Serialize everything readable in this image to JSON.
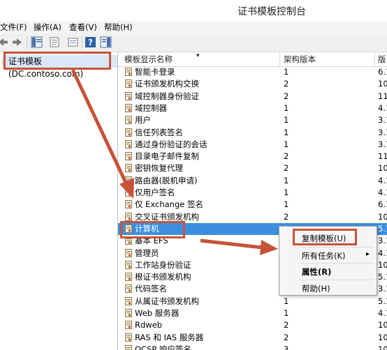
{
  "window": {
    "title": "证书模板控制台"
  },
  "menubar": [
    "文件(F)",
    "操作(A)",
    "查看(V)",
    "帮助(H)"
  ],
  "tree": {
    "root_label": "证书模板(DC.contoso.com)"
  },
  "list": {
    "columns": [
      "模板显示名称",
      "架构版本",
      "版"
    ],
    "rows": [
      {
        "name": "智能卡登录",
        "schema": "1",
        "ver": "6.1"
      },
      {
        "name": "证书颁发机构交换",
        "schema": "2",
        "ver": "10"
      },
      {
        "name": "域控制器身份验证",
        "schema": "2",
        "ver": "11"
      },
      {
        "name": "域控制器",
        "schema": "1",
        "ver": "4.1"
      },
      {
        "name": "用户",
        "schema": "1",
        "ver": "3.1"
      },
      {
        "name": "信任列表签名",
        "schema": "1",
        "ver": "3.1"
      },
      {
        "name": "通过身份验证的会话",
        "schema": "1",
        "ver": "3.1"
      },
      {
        "name": "目录电子邮件复制",
        "schema": "2",
        "ver": "11"
      },
      {
        "name": "密钥恢复代理",
        "schema": "2",
        "ver": "10"
      },
      {
        "name": "路由器(脱机申请)",
        "schema": "1",
        "ver": "4.1"
      },
      {
        "name": "仅用户签名",
        "schema": "1",
        "ver": "4.1"
      },
      {
        "name": "仅 Exchange 签名",
        "schema": "1",
        "ver": "6.1"
      },
      {
        "name": "交叉证书颁发机构",
        "schema": "2",
        "ver": "10"
      },
      {
        "name": "计算机",
        "schema": "1",
        "ver": "5.1"
      },
      {
        "name": "基本 EFS",
        "schema": "",
        "ver": "3.1"
      },
      {
        "name": "管理员",
        "schema": "",
        "ver": "4.1"
      },
      {
        "name": "工作站身份验证",
        "schema": "",
        "ver": "10"
      },
      {
        "name": "根证书颁发机构",
        "schema": "",
        "ver": "5.1"
      },
      {
        "name": "代码签名",
        "schema": "",
        "ver": "3.1"
      },
      {
        "name": "从属证书颁发机构",
        "schema": "1",
        "ver": "5.1"
      },
      {
        "name": "Web 服务器",
        "schema": "1",
        "ver": "4.1"
      },
      {
        "name": "Rdweb",
        "schema": "2",
        "ver": "10"
      },
      {
        "name": "RAS 和 IAS 服务器",
        "schema": "2",
        "ver": "10"
      },
      {
        "name": "OCSP 响应签名",
        "schema": "3",
        "ver": "10"
      }
    ],
    "selected_index": 13
  },
  "context_menu": {
    "items": [
      "复制模板(U)",
      "所有任务(K)",
      "属性(R)",
      "帮助(H)"
    ],
    "submenu_glyph": "▸"
  },
  "colors": {
    "annotation": "#c65339",
    "selection": "#3c8fde"
  }
}
